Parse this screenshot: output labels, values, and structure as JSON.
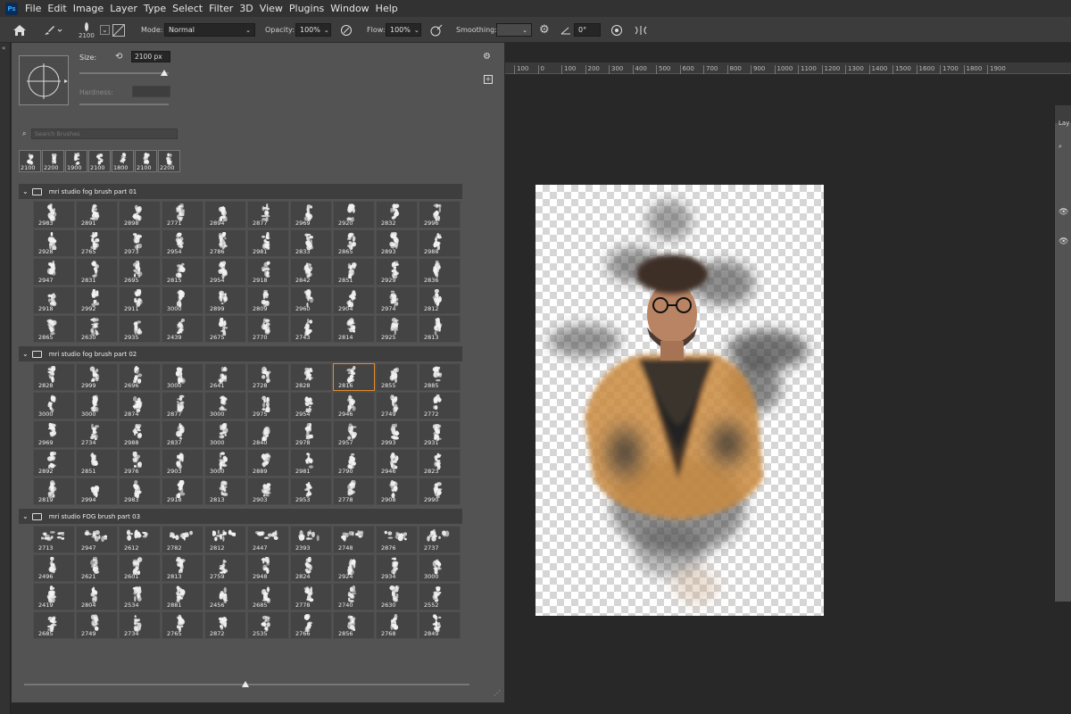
{
  "menubar": {
    "logo": "Ps",
    "items": [
      "File",
      "Edit",
      "Image",
      "Layer",
      "Type",
      "Select",
      "Filter",
      "3D",
      "View",
      "Plugins",
      "Window",
      "Help"
    ]
  },
  "options": {
    "brush_size": "2100",
    "mode_label": "Mode:",
    "mode_value": "Normal",
    "opacity_label": "Opacity:",
    "opacity_value": "100%",
    "flow_label": "Flow:",
    "flow_value": "100%",
    "smoothing_label": "Smoothing:",
    "smoothing_value": "",
    "angle_value": "0°"
  },
  "brush_panel": {
    "size_label": "Size:",
    "size_value": "2100 px",
    "hardness_label": "Hardness:",
    "search_placeholder": "Search Brushes",
    "recent": [
      "2100",
      "2200",
      "1900",
      "2100",
      "1800",
      "2100",
      "2200"
    ],
    "groups": [
      {
        "name": "mri studio fog brush part 01",
        "brushes": [
          "2983",
          "2891",
          "2898",
          "2771",
          "2894",
          "2877",
          "2969",
          "2920",
          "2832",
          "2996",
          "2928",
          "2765",
          "2973",
          "2954",
          "2786",
          "2981",
          "2833",
          "2865",
          "2893",
          "2988",
          "2947",
          "2831",
          "2695",
          "2815",
          "2954",
          "2918",
          "2842",
          "2851",
          "2929",
          "2836",
          "2918",
          "2992",
          "2911",
          "3000",
          "2899",
          "2809",
          "2960",
          "2904",
          "2974",
          "2812",
          "2865",
          "2630",
          "2935",
          "2439",
          "2675",
          "2770",
          "2743",
          "2814",
          "2925",
          "2813"
        ]
      },
      {
        "name": "mri studio fog brush part 02",
        "brushes": [
          "2828",
          "2999",
          "2696",
          "3000",
          "2641",
          "2728",
          "2828",
          "2816",
          "2855",
          "2885",
          "3000",
          "3000",
          "2874",
          "2877",
          "3000",
          "2975",
          "2954",
          "2946",
          "2749",
          "2772",
          "2969",
          "2734",
          "2988",
          "2837",
          "3000",
          "2840",
          "2978",
          "2957",
          "2993",
          "2931",
          "2892",
          "2851",
          "2976",
          "2903",
          "3000",
          "2889",
          "2981",
          "2790",
          "2946",
          "2823",
          "2819",
          "2994",
          "2983",
          "2918",
          "2813",
          "2903",
          "2953",
          "2778",
          "2908",
          "2990"
        ],
        "selected_index": 7
      },
      {
        "name": "mri studio FOG brush part 03",
        "brushes": [
          "2713",
          "2947",
          "2612",
          "2782",
          "2812",
          "2447",
          "2393",
          "2748",
          "2876",
          "2737",
          "2496",
          "2621",
          "2601",
          "2813",
          "2759",
          "2948",
          "2824",
          "2924",
          "2934",
          "3000",
          "2419",
          "2804",
          "2534",
          "2881",
          "2456",
          "2685",
          "2778",
          "2740",
          "2630",
          "2552",
          "2685",
          "2749",
          "2734",
          "2765",
          "2872",
          "2535",
          "2766",
          "2856",
          "2768",
          "2849"
        ]
      }
    ]
  },
  "ruler": [
    "100",
    "0",
    "100",
    "200",
    "300",
    "400",
    "500",
    "600",
    "700",
    "800",
    "900",
    "1000",
    "1100",
    "1200",
    "1300",
    "1400",
    "1500",
    "1600",
    "1700",
    "1800",
    "1900"
  ],
  "right_panel": {
    "title": "Lay"
  },
  "colors": {
    "accent": "#e08a2e",
    "panel": "#535353",
    "workspace": "#282828"
  }
}
